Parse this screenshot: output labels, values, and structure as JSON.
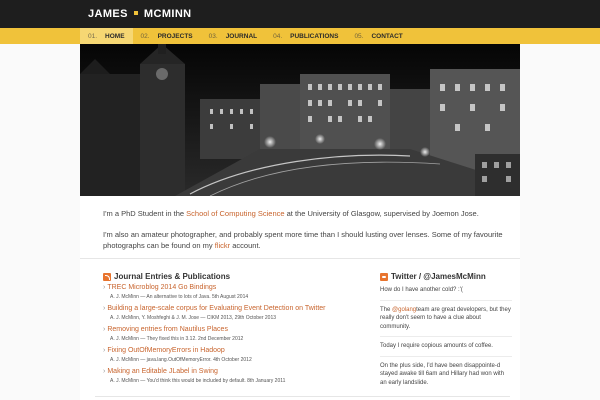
{
  "header": {
    "brand_first": "JAMES",
    "brand_last": "MCMINN"
  },
  "nav": [
    {
      "num": "01.",
      "label": "HOME",
      "active": true
    },
    {
      "num": "02.",
      "label": "PROJECTS",
      "active": false
    },
    {
      "num": "03.",
      "label": "JOURNAL",
      "active": false
    },
    {
      "num": "04.",
      "label": "PUBLICATIONS",
      "active": false
    },
    {
      "num": "05.",
      "label": "CONTACT",
      "active": false
    }
  ],
  "intro": {
    "p1_pre": "I'm a PhD Student in the ",
    "p1_link": "School of Computing Science",
    "p1_post": " at the University of Glasgow, supervised by Joemon Jose.",
    "p2_pre": "I'm also an amateur photographer, and probably spent more time than I should lusting over lenses. Some of my favourite photographs can be found on my ",
    "p2_link": "flickr",
    "p2_post": " account."
  },
  "journal": {
    "title": "Journal Entries & Publications",
    "entries": [
      {
        "title": "TREC Microblog 2014 Go Bindings",
        "meta": "A. J. McMinn — An alternative to lots of Java. 5th August 2014"
      },
      {
        "title": "Building a large-scale corpus for Evaluating Event Detection on Twitter",
        "meta": "A. J. McMinn, Y. Moshfeghi & J. M. Jose — CIKM 2013, 29th October 2013"
      },
      {
        "title": "Removing entries from Nautilus Places",
        "meta": "A. J. McMinn — They fixed this in 3.12. 2nd December 2012"
      },
      {
        "title": "Fixing OutOfMemoryErrors in Hadoop",
        "meta": "A. J. McMinn — java.lang.OutOfMemoryError. 4th October 2012"
      },
      {
        "title": "Making an Editable JLabel in Swing",
        "meta": "A. J. McMinn — You'd think this would be included by default. 8th January 2011"
      }
    ]
  },
  "twitter": {
    "title": "Twitter / @JamesMcMinn",
    "tweets": [
      {
        "pre": "How do I have another cold? :'(",
        "link": "",
        "post": ""
      },
      {
        "pre": "The ",
        "link": "@golang",
        "post": "team are great developers, but they really don't seem to have a clue about community."
      },
      {
        "pre": "Today I require copious amounts of coffee.",
        "link": "",
        "post": ""
      },
      {
        "pre": "On the plus side, I'd have been disappointe-d stayed awake till 6am and Hillary had won with an early landslide.",
        "link": "",
        "post": ""
      }
    ]
  },
  "colors": {
    "accent": "#f0c23a",
    "link": "#c8642d",
    "header_bg": "#1e1e1e"
  }
}
